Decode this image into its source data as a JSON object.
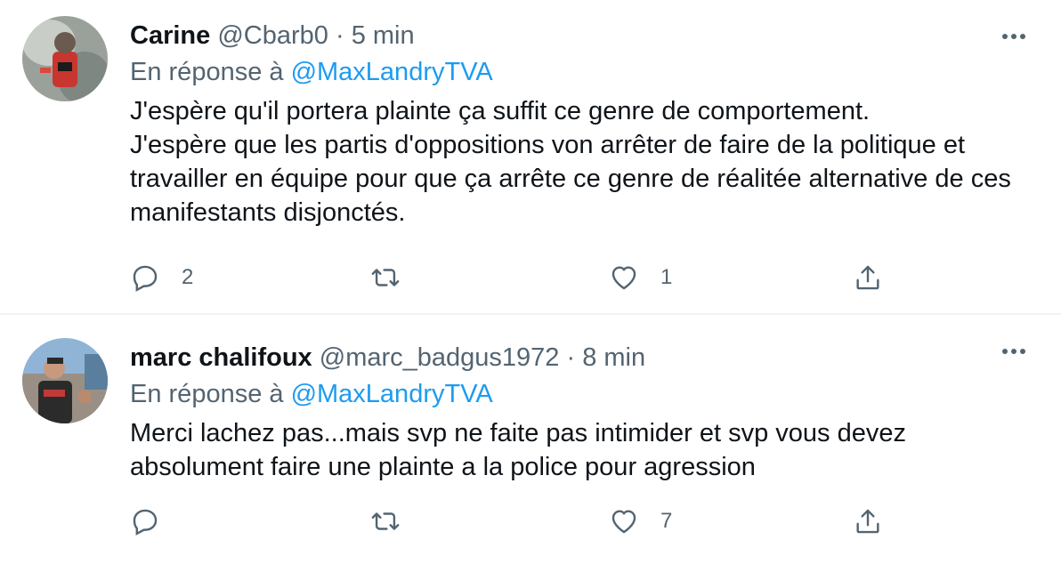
{
  "tweets": [
    {
      "display_name": "Carine",
      "handle": "@Cbarb0",
      "separator": "·",
      "time": "5 min",
      "reply_prefix": "En réponse à",
      "reply_to": "@MaxLandryTVA",
      "text": "J'espère qu'il portera plainte ça suffit ce genre de comportement.\nJ'espère que les partis d'oppositions von arrêter de faire de la politique et travailler en équipe pour que ça arrête ce genre de réalitée alternative de ces manifestants disjonctés.",
      "reply_count": "2",
      "retweet_count": "",
      "like_count": "1"
    },
    {
      "display_name": "marc chalifoux",
      "handle": "@marc_badgus1972",
      "separator": "·",
      "time": "8 min",
      "reply_prefix": "En réponse à",
      "reply_to": "@MaxLandryTVA",
      "text": "Merci lachez pas...mais svp ne faite pas intimider  et svp vous devez absolument faire une plainte a la police pour agression",
      "reply_count": "",
      "retweet_count": "",
      "like_count": "7"
    }
  ],
  "icons": {
    "more": "more-horizontal-icon",
    "reply": "reply-bubble-icon",
    "retweet": "retweet-icon",
    "like": "heart-icon",
    "share": "share-icon"
  },
  "colors": {
    "text": "#0f1419",
    "secondary": "#536471",
    "mention": "#1d9bf0",
    "divider": "#eff3f4"
  }
}
